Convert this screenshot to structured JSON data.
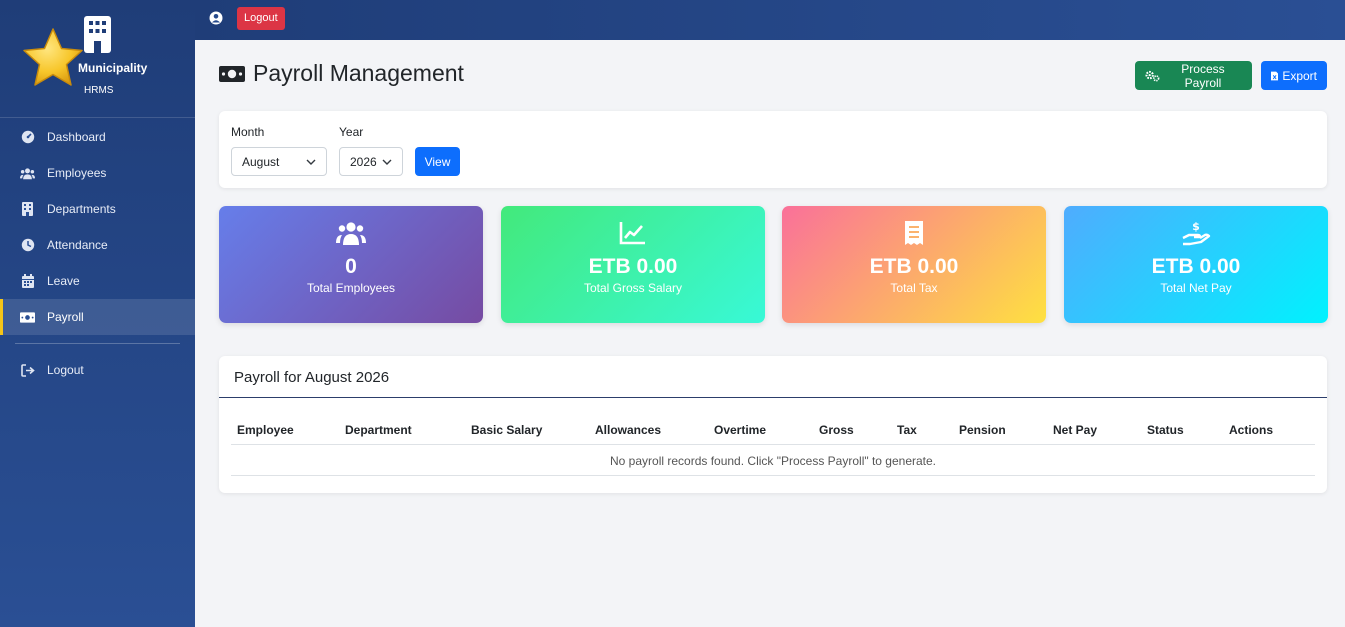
{
  "brand": {
    "name": "Municipality",
    "sub": "HRMS"
  },
  "sidebar": {
    "items": [
      {
        "label": "Dashboard",
        "icon": "gauge-icon"
      },
      {
        "label": "Employees",
        "icon": "users-icon"
      },
      {
        "label": "Departments",
        "icon": "building-icon"
      },
      {
        "label": "Attendance",
        "icon": "clock-icon"
      },
      {
        "label": "Leave",
        "icon": "calendar-icon"
      },
      {
        "label": "Payroll",
        "icon": "money-bill-icon",
        "active": true
      }
    ],
    "logout_label": "Logout"
  },
  "topbar": {
    "logout_label": "Logout"
  },
  "page": {
    "title": "Payroll Management",
    "process_label": "Process Payroll",
    "export_label": "Export"
  },
  "filter": {
    "month_label": "Month",
    "month_value": "August",
    "year_label": "Year",
    "year_value": "2026",
    "view_label": "View"
  },
  "stats": [
    {
      "value": "0",
      "label": "Total Employees",
      "icon": "users-icon"
    },
    {
      "value": "ETB 0.00",
      "label": "Total Gross Salary",
      "icon": "chart-line-icon"
    },
    {
      "value": "ETB 0.00",
      "label": "Total Tax",
      "icon": "receipt-icon"
    },
    {
      "value": "ETB 0.00",
      "label": "Total Net Pay",
      "icon": "hand-dollar-icon"
    }
  ],
  "table": {
    "title": "Payroll for August 2026",
    "columns": [
      "Employee",
      "Department",
      "Basic Salary",
      "Allowances",
      "Overtime",
      "Gross",
      "Tax",
      "Pension",
      "Net Pay",
      "Status",
      "Actions"
    ],
    "empty_message": "No payroll records found. Click \"Process Payroll\" to generate."
  },
  "colors": {
    "sidebar": "#1f3d78",
    "logout": "#dc3545",
    "process": "#198754",
    "export": "#0d6efd",
    "active_accent": "#f5c518"
  }
}
